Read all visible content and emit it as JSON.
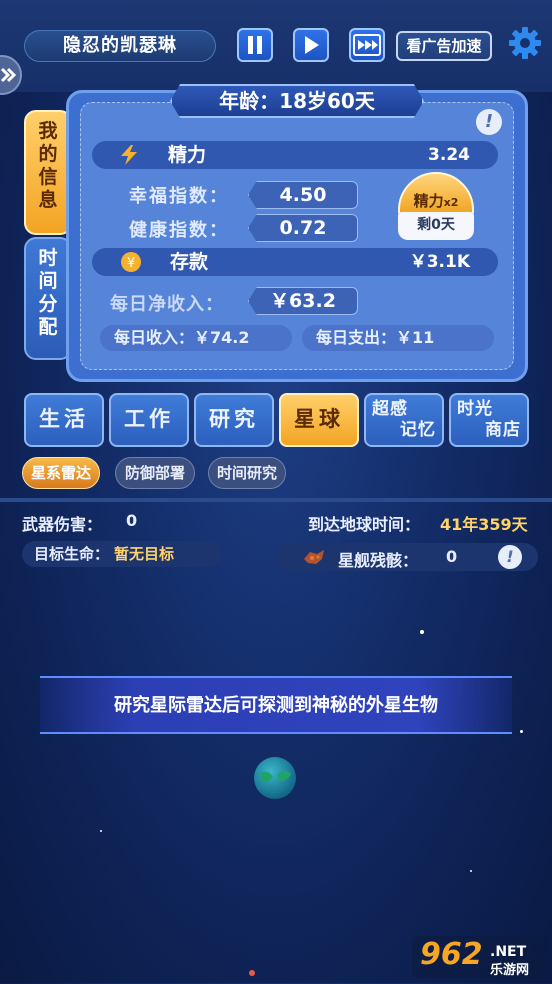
{
  "header": {
    "player_name": "隐忍的凯瑟琳",
    "ad_boost_label": "看广告加速"
  },
  "side_tabs": [
    {
      "label": "我的信息",
      "chars": [
        "我",
        "的",
        "信",
        "息"
      ],
      "active": true
    },
    {
      "label": "时间分配",
      "chars": [
        "时",
        "间",
        "分",
        "配"
      ],
      "active": false
    }
  ],
  "info": {
    "age": "年龄：18岁60天",
    "energy_label": "精力",
    "energy_value": "3.24",
    "happiness_label": "幸福指数：",
    "happiness_value": "4.50",
    "health_label": "健康指数：",
    "health_value": "0.72",
    "savings_label": "存款",
    "savings_value": "￥3.1K",
    "net_income_label": "每日净收入：",
    "net_income_value": "￥63.2",
    "daily_income": "每日收入：￥74.2",
    "daily_expense": "每日支出：￥11",
    "energy_badge_title": "精力",
    "energy_badge_mult": "x2",
    "energy_badge_remaining": "剩0天"
  },
  "category_tabs": [
    {
      "label": "生活",
      "lines": [
        "生活"
      ],
      "active": false
    },
    {
      "label": "工作",
      "lines": [
        "工作"
      ],
      "active": false
    },
    {
      "label": "研究",
      "lines": [
        "研究"
      ],
      "active": false
    },
    {
      "label": "星球",
      "lines": [
        "星球"
      ],
      "active": true
    },
    {
      "label": "超感记忆",
      "lines": [
        "超感",
        "记忆"
      ],
      "active": false
    },
    {
      "label": "时光商店",
      "lines": [
        "时光",
        "商店"
      ],
      "active": false
    }
  ],
  "sub_tabs": [
    {
      "label": "星系雷达",
      "active": true
    },
    {
      "label": "防御部署",
      "active": false
    },
    {
      "label": "时间研究",
      "active": false
    }
  ],
  "planet_stats": {
    "weapon_damage_label": "武器伤害：",
    "weapon_damage_value": "0",
    "arrival_label": "到达地球时间：",
    "arrival_value": "41年359天",
    "target_life_label": "目标生命：",
    "target_life_value": "暂无目标",
    "wreckage_label": "星舰残骸：",
    "wreckage_value": "0"
  },
  "message": "研究星际雷达后可探测到神秘的外星生物",
  "watermark": {
    "brand": "962.NET",
    "sub": "乐游网"
  },
  "colors": {
    "accent_gold": "#f3a424",
    "panel_blue": "#3d6fd0",
    "background": "#15306e"
  }
}
